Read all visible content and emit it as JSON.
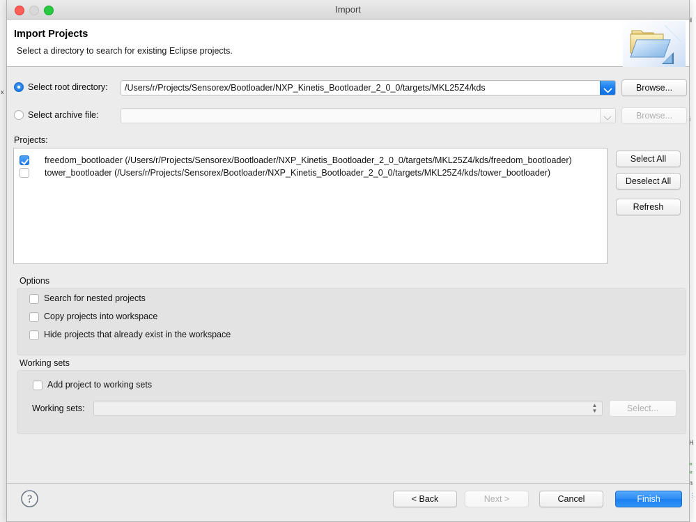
{
  "window": {
    "title": "Import",
    "controls": {
      "close": "close-button",
      "minimize": "minimize-button",
      "zoom": "zoom-button"
    }
  },
  "header": {
    "title": "Import Projects",
    "description": "Select a directory to search for existing Eclipse projects.",
    "banner_icon": "import-folder-icon"
  },
  "source": {
    "root_directory": {
      "radio_label": "Select root directory:",
      "selected": true,
      "value": "/Users/r/Projects/Sensorex/Bootloader/NXP_Kinetis_Bootloader_2_0_0/targets/MKL25Z4/kds",
      "browse_label": "Browse...",
      "browse_enabled": true
    },
    "archive_file": {
      "radio_label": "Select archive file:",
      "selected": false,
      "value": "",
      "browse_label": "Browse...",
      "browse_enabled": false
    }
  },
  "projects": {
    "label": "Projects:",
    "items": [
      {
        "checked": true,
        "text": "freedom_bootloader (/Users/r/Projects/Sensorex/Bootloader/NXP_Kinetis_Bootloader_2_0_0/targets/MKL25Z4/kds/freedom_bootloader)"
      },
      {
        "checked": false,
        "text": "tower_bootloader (/Users/r/Projects/Sensorex/Bootloader/NXP_Kinetis_Bootloader_2_0_0/targets/MKL25Z4/kds/tower_bootloader)"
      }
    ],
    "buttons": {
      "select_all": "Select All",
      "deselect_all": "Deselect All",
      "refresh": "Refresh"
    }
  },
  "options": {
    "group_label": "Options",
    "items": [
      {
        "label": "Search for nested projects",
        "checked": false
      },
      {
        "label": "Copy projects into workspace",
        "checked": false
      },
      {
        "label": "Hide projects that already exist in the workspace",
        "checked": false
      }
    ]
  },
  "working_sets": {
    "group_label": "Working sets",
    "add_checkbox": {
      "label": "Add project to working sets",
      "checked": false
    },
    "field_label": "Working sets:",
    "field_value": "",
    "select_button": {
      "label": "Select...",
      "enabled": false
    }
  },
  "footer": {
    "help_icon": "help-question-icon",
    "back": {
      "label": "< Back",
      "enabled": true
    },
    "next": {
      "label": "Next >",
      "enabled": false
    },
    "cancel": {
      "label": "Cancel",
      "enabled": true
    },
    "finish": {
      "label": "Finish",
      "enabled": true,
      "is_default": true
    }
  },
  "colors": {
    "accent_blue": "#1a7bef",
    "dialog_background": "#ececec",
    "header_background": "#ffffff",
    "group_background": "#e3e3e3"
  },
  "background_window": {
    "left_fragments": [
      "x"
    ],
    "right_fragments": [
      "il",
      "i",
      "H",
      "«",
      "«",
      "n",
      "⋮"
    ]
  }
}
